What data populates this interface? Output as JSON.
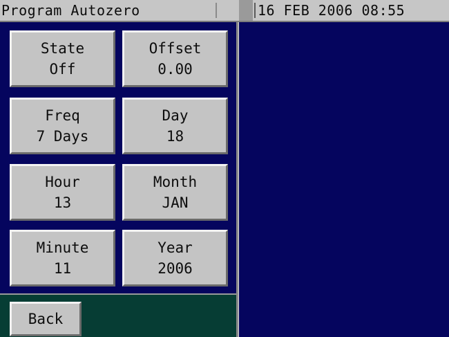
{
  "window": {
    "title": "Program Autozero",
    "datetime": "16 FEB 2006 08:55"
  },
  "buttons": [
    {
      "label": "State",
      "value": "Off"
    },
    {
      "label": "Offset",
      "value": "0.00"
    },
    {
      "label": "Freq",
      "value": "7 Days"
    },
    {
      "label": "Day",
      "value": "18"
    },
    {
      "label": "Hour",
      "value": "13"
    },
    {
      "label": "Month",
      "value": "JAN"
    },
    {
      "label": "Minute",
      "value": "11"
    },
    {
      "label": "Year",
      "value": "2006"
    }
  ],
  "footer": {
    "back_label": "Back"
  },
  "colors": {
    "background": "#05055e",
    "footer": "#063d34",
    "button_face": "#c4c4c4",
    "title_bar": "#c6c6c6"
  }
}
